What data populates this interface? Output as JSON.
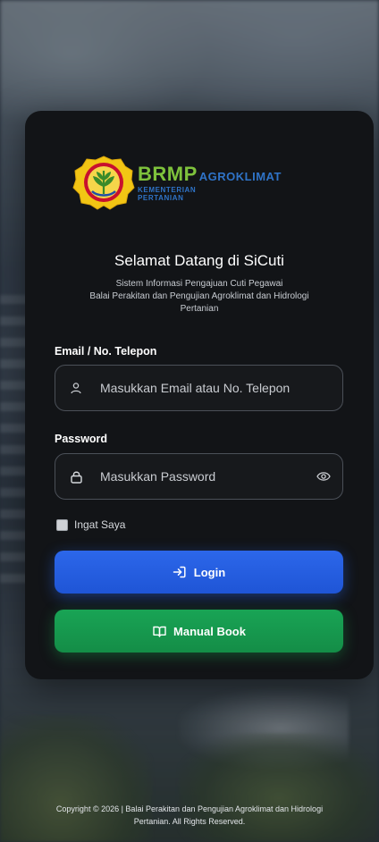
{
  "brand": {
    "name": "BRMP",
    "suffix": "AGROKLIMAT",
    "ministry_line1": "KEMENTERIAN",
    "ministry_line2": "PERTANIAN"
  },
  "header": {
    "welcome": "Selamat Datang di SiCuti",
    "subtitle_line1": "Sistem Informasi Pengajuan Cuti Pegawai",
    "subtitle_line2": "Balai Perakitan dan Pengujian Agroklimat dan Hidrologi",
    "subtitle_line3": "Pertanian"
  },
  "form": {
    "email_label": "Email / No. Telepon",
    "email_placeholder": "Masukkan Email atau No. Telepon",
    "password_label": "Password",
    "password_placeholder": "Masukkan Password",
    "remember_label": "Ingat Saya",
    "remember_checked": false
  },
  "buttons": {
    "login_label": "Login",
    "manual_label": "Manual Book"
  },
  "footer": {
    "line1": "Copyright © 2026  |  Balai Perakitan dan Pengujian Agroklimat dan Hidrologi",
    "line2": "Pertanian. All Rights Reserved."
  },
  "colors": {
    "card_bg": "#121417",
    "brand_green": "#7ec23c",
    "brand_blue": "#2f73c7",
    "login_blue": "#2563eb",
    "manual_green": "#16a34a"
  }
}
